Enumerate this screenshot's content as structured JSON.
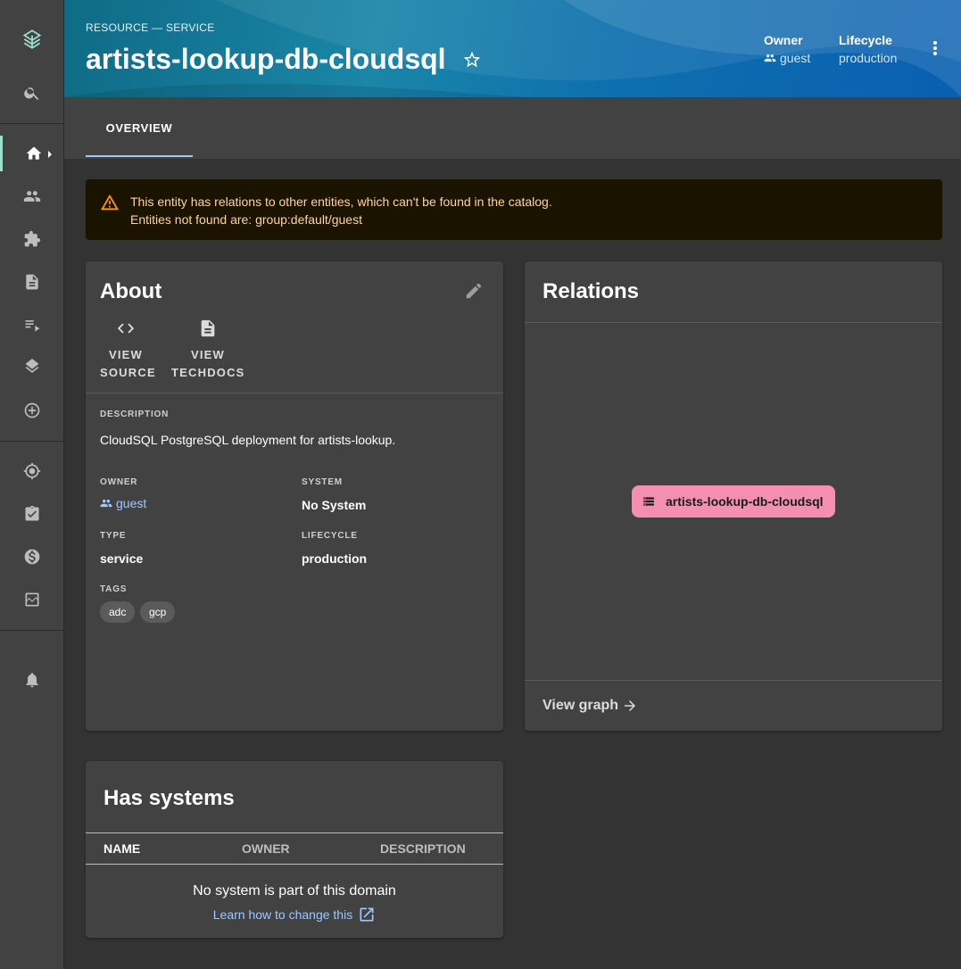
{
  "header": {
    "breadcrumb": "RESOURCE — SERVICE",
    "title": "artists-lookup-db-cloudsql",
    "owner_label": "Owner",
    "owner_value": "guest",
    "lifecycle_label": "Lifecycle",
    "lifecycle_value": "production"
  },
  "tabs": [
    {
      "label": "OVERVIEW"
    }
  ],
  "warning": {
    "line1": "This entity has relations to other entities, which can't be found in the catalog.",
    "line2": "Entities not found are: group:default/guest"
  },
  "about": {
    "title": "About",
    "view_source_l1": "VIEW",
    "view_source_l2": "SOURCE",
    "view_techdocs_l1": "VIEW",
    "view_techdocs_l2": "TECHDOCS",
    "description_label": "DESCRIPTION",
    "description": "CloudSQL PostgreSQL deployment for artists-lookup.",
    "owner_label": "OWNER",
    "owner": "guest",
    "system_label": "SYSTEM",
    "system": "No System",
    "type_label": "TYPE",
    "type": "service",
    "lifecycle_label": "LIFECYCLE",
    "lifecycle": "production",
    "tags_label": "TAGS",
    "tags": [
      "adc",
      "gcp"
    ]
  },
  "relations": {
    "title": "Relations",
    "node": "artists-lookup-db-cloudsql",
    "view_graph": "View graph"
  },
  "systems": {
    "title": "Has systems",
    "columns": [
      "NAME",
      "OWNER",
      "DESCRIPTION"
    ],
    "empty": "No system is part of this domain",
    "learn": "Learn how to change this"
  },
  "colors": {
    "accent": "#9cc9ff",
    "node": "#f48fb1",
    "warning_text": "#ffd59a",
    "active_indicator": "#9be1d0"
  }
}
